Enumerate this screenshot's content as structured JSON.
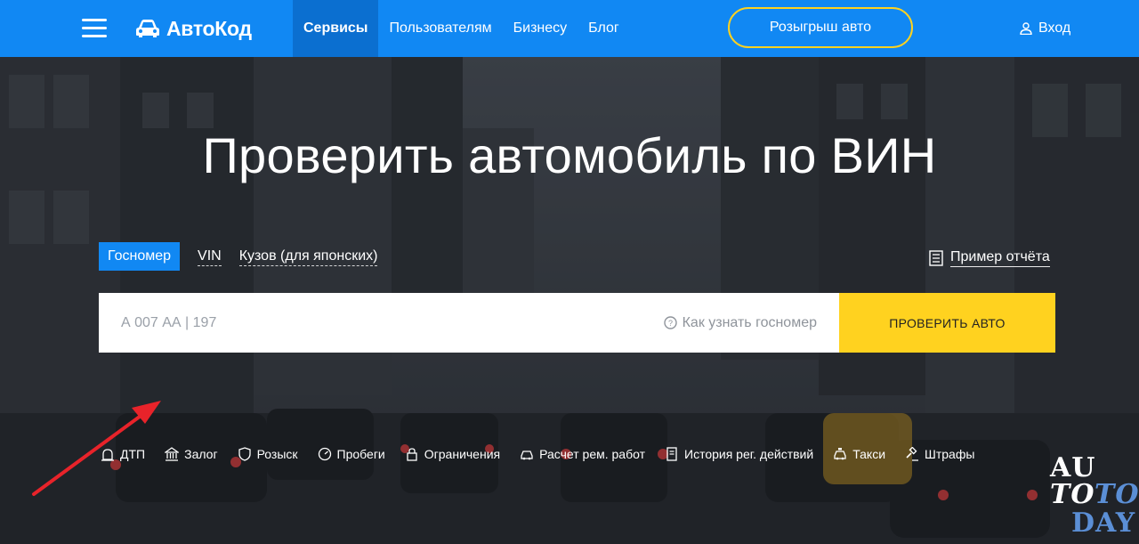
{
  "header": {
    "logo_text": "АвтоКод",
    "nav": [
      "Сервисы",
      "Пользователям",
      "Бизнесу",
      "Блог"
    ],
    "promo_label": "Розыгрыш авто",
    "login_label": "Вход"
  },
  "hero": {
    "title": "Проверить автомобиль по ВИН",
    "tabs": [
      "Госномер",
      "VIN",
      "Кузов (для японских)"
    ],
    "active_tab": "Госномер",
    "sample_report_label": "Пример отчёта",
    "search": {
      "placeholder": "А 007 АА | 197",
      "value": "",
      "hint_label": "Как узнать госномер",
      "submit_label": "ПРОВЕРИТЬ АВТО"
    },
    "services": [
      "ДТП",
      "Залог",
      "Розыск",
      "Пробеги",
      "Ограничения",
      "Расчет рем. работ",
      "История рег. действий",
      "Такси",
      "Штрафы"
    ]
  },
  "watermark": {
    "line1": "AU",
    "line2_a": "TO",
    "line2_b": "TO",
    "line3": "DAY"
  },
  "colors": {
    "brand_blue": "#1188f3",
    "active_nav": "#0b6fd0",
    "accent_yellow": "#ffd21f",
    "annotation_red": "#e8232a"
  }
}
